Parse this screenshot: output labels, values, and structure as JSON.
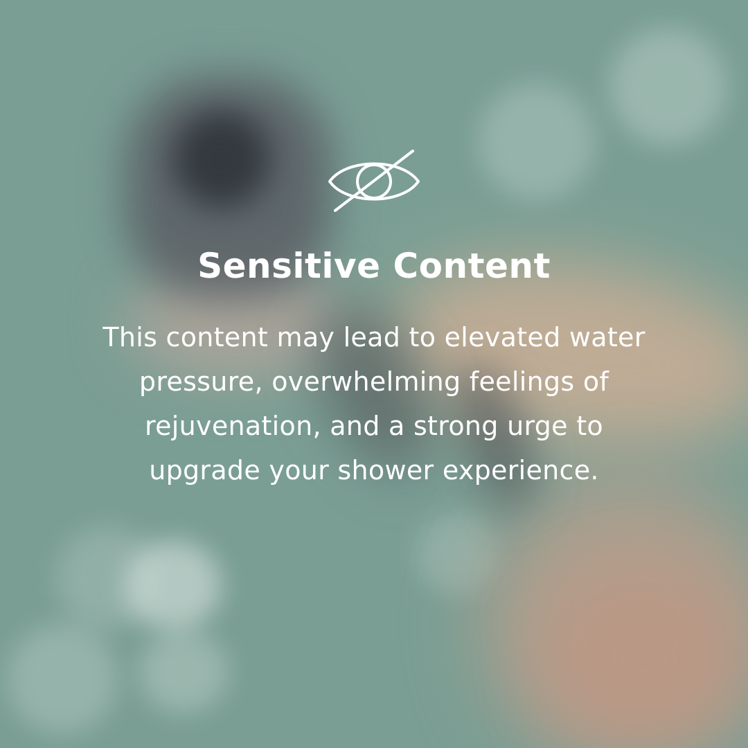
{
  "background": {
    "base_color": "#7a9e94",
    "accent_colors": [
      "#5b5f66",
      "#d8b39c",
      "#dfe9e6"
    ]
  },
  "warning": {
    "icon": "eye-slash-icon",
    "title": "Sensitive Content",
    "message": "This content may lead to elevated water pressure, overwhelming feelings of rejuvenation, and a strong urge to upgrade your shower experience.",
    "text_color": "#ffffff"
  }
}
